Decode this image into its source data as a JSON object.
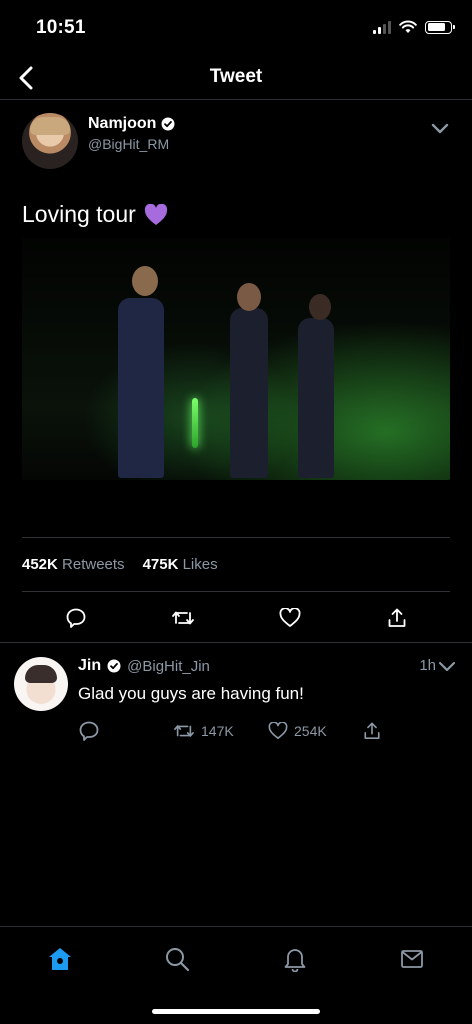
{
  "status_bar": {
    "time": "10:51"
  },
  "header": {
    "title": "Tweet"
  },
  "tweet": {
    "author_name": "Namjoon",
    "author_handle": "@BigHit_RM",
    "text": "Loving tour",
    "emoji": "💜",
    "retweets_count": "452K",
    "retweets_label": "Retweets",
    "likes_count": "475K",
    "likes_label": "Likes"
  },
  "reply": {
    "author_name": "Jin",
    "author_handle": "@BigHit_Jin",
    "time": "1h",
    "text": "Glad you guys are having fun!",
    "retweets": "147K",
    "likes": "254K"
  },
  "icons": {
    "verified": "verified-badge-icon",
    "reply": "reply-bubble-icon",
    "retweet": "retweet-icon",
    "like": "heart-icon",
    "share": "share-icon",
    "home": "home-icon",
    "search": "search-icon",
    "notifications": "bell-icon",
    "messages": "mail-icon"
  },
  "colors": {
    "accent": "#1d9bf0",
    "muted": "#8b98a5",
    "divider": "#2f3336"
  }
}
